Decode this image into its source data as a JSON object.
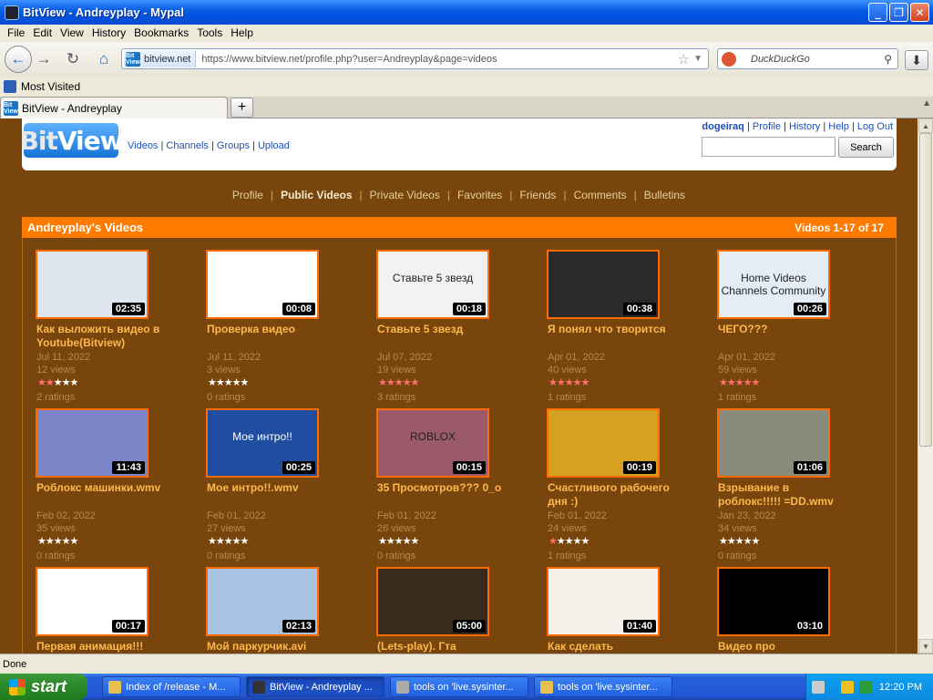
{
  "window": {
    "title": "BitView - Andreyplay - Mypal"
  },
  "menu": [
    "File",
    "Edit",
    "View",
    "History",
    "Bookmarks",
    "Tools",
    "Help"
  ],
  "navbar": {
    "site_label": "bitview.net",
    "favicon_text": "Bit View",
    "url": "https://www.bitview.net/profile.php?user=Andreyplay&page=videos",
    "search_placeholder": "DuckDuckGo"
  },
  "bookmarks": [
    "Most Visited"
  ],
  "tab": {
    "label": "BitView - Andreyplay",
    "new_tab": "+"
  },
  "site": {
    "logo_bit": "Bit",
    "logo_view": "View",
    "topnav": [
      "Videos",
      "Channels",
      "Groups",
      "Upload"
    ],
    "user": "dogeiraq",
    "userlinks": [
      "Profile",
      "History",
      "Help",
      "Log Out"
    ],
    "search_button": "Search"
  },
  "subnav": {
    "items": [
      "Profile",
      "Public Videos",
      "Private Videos",
      "Favorites",
      "Friends",
      "Comments",
      "Bulletins"
    ],
    "current": "Public Videos"
  },
  "videos_header": {
    "title": "Andreyplay's Videos",
    "count": "Videos 1-17 of 17"
  },
  "videos": [
    {
      "title": "Как выложить видео в Youtube(Bitview)",
      "duration": "02:35",
      "date": "Jul 11, 2022",
      "views": "12 views",
      "ratings": "2 ratings",
      "stars_filled": 2,
      "thumb_color": "#dfe6f0",
      "thumb_text": ""
    },
    {
      "title": "Проверка видео",
      "duration": "00:08",
      "date": "Jul 11, 2022",
      "views": "3 views",
      "ratings": "0 ratings",
      "stars_filled": 0,
      "thumb_color": "#ffffff",
      "thumb_text": ""
    },
    {
      "title": "Ставьте 5 звезд",
      "duration": "00:18",
      "date": "Jul 07, 2022",
      "views": "19 views",
      "ratings": "3 ratings",
      "stars_filled": 5,
      "thumb_color": "#f2f2f2",
      "thumb_text": "Ставьте 5 звезд"
    },
    {
      "title": "Я понял что творится",
      "duration": "00:38",
      "date": "Apr 01, 2022",
      "views": "40 views",
      "ratings": "1 ratings",
      "stars_filled": 5,
      "thumb_color": "#2a2a2a",
      "thumb_text": ""
    },
    {
      "title": "ЧЕГО???",
      "duration": "00:26",
      "date": "Apr 01, 2022",
      "views": "59 views",
      "ratings": "1 ratings",
      "stars_filled": 5,
      "thumb_color": "#e4ecf6",
      "thumb_text": "Home Videos Channels Community"
    },
    {
      "title": "Роблокс машинки.wmv",
      "duration": "11:43",
      "date": "Feb 02, 2022",
      "views": "35 views",
      "ratings": "0 ratings",
      "stars_filled": 0,
      "thumb_color": "#7a86c8",
      "thumb_text": ""
    },
    {
      "title": "Мое интро!!.wmv",
      "duration": "00:25",
      "date": "Feb 01, 2022",
      "views": "27 views",
      "ratings": "0 ratings",
      "stars_filled": 0,
      "thumb_color": "#1f4ea0",
      "thumb_text": "Мое интро!!"
    },
    {
      "title": "35 Просмотров??? 0_o",
      "duration": "00:15",
      "date": "Feb 01, 2022",
      "views": "26 views",
      "ratings": "0 ratings",
      "stars_filled": 0,
      "thumb_color": "#9a5a6a",
      "thumb_text": "ROBLOX"
    },
    {
      "title": "Счастливого рабочего дня :)",
      "duration": "00:19",
      "date": "Feb 01, 2022",
      "views": "24 views",
      "ratings": "1 ratings",
      "stars_filled": 1,
      "thumb_color": "#d6a020",
      "thumb_text": ""
    },
    {
      "title": "Взрывание в роблокс!!!!! =DD.wmv",
      "duration": "01:06",
      "date": "Jan 23, 2022",
      "views": "34 views",
      "ratings": "0 ratings",
      "stars_filled": 0,
      "thumb_color": "#8a8a7a",
      "thumb_text": ""
    },
    {
      "title": "Первая анимация!!!",
      "duration": "00:17",
      "thumb_color": "#ffffff",
      "thumb_text": ""
    },
    {
      "title": "Мой паркурчик.avi",
      "duration": "02:13",
      "thumb_color": "#aac2e2",
      "thumb_text": ""
    },
    {
      "title": "(Lets-play). Гта",
      "duration": "05:00",
      "thumb_color": "#3a2a1a",
      "thumb_text": ""
    },
    {
      "title": "Как сделать",
      "duration": "01:40",
      "thumb_color": "#f4f0ea",
      "thumb_text": ""
    },
    {
      "title": "Видео про",
      "duration": "03:10",
      "thumb_color": "#000000",
      "thumb_text": ""
    }
  ],
  "status": "Done",
  "taskbar": {
    "start": "start",
    "tasks": [
      "Index of /release - M...",
      "BitView - Andreyplay ...",
      "tools on 'live.sysinter...",
      "tools on 'live.sysinter..."
    ],
    "clock": "12:20 PM"
  }
}
